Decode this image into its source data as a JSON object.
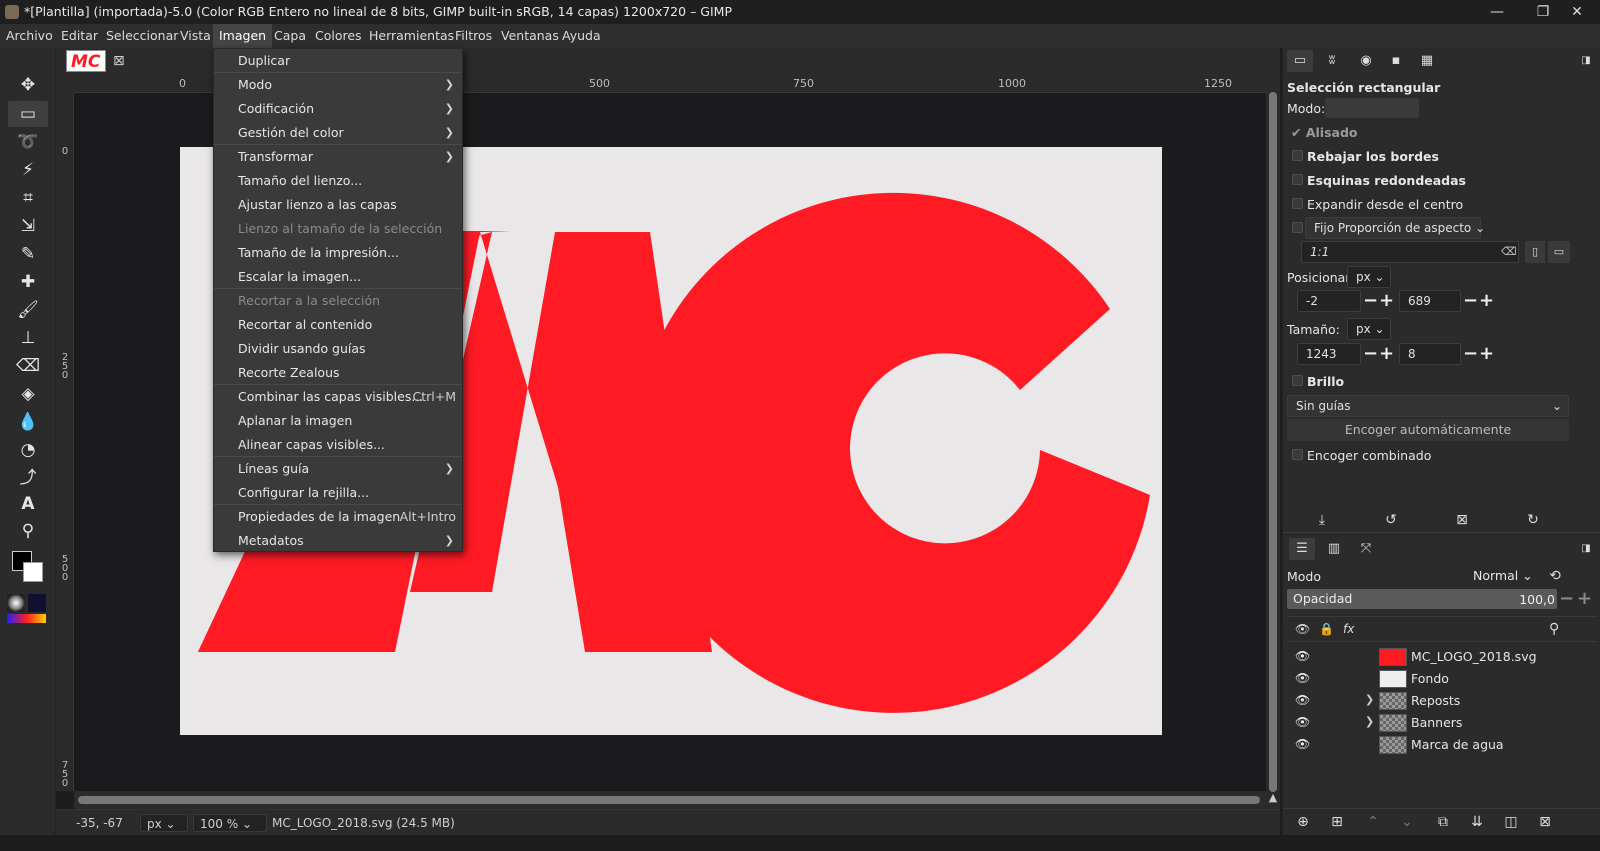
{
  "window": {
    "title": "*[Plantilla] (importada)-5.0 (Color RGB Entero no lineal de 8 bits, GIMP built-in sRGB, 14 capas) 1200x720 – GIMP",
    "minimize": "—",
    "maximize": "❐",
    "close": "✕"
  },
  "menubar": [
    "Archivo",
    "Editar",
    "Seleccionar",
    "Vista",
    "Imagen",
    "Capa",
    "Colores",
    "Herramientas",
    "Filtros",
    "Ventanas",
    "Ayuda"
  ],
  "image_tab": {
    "thumb_text": "MC",
    "close_glyph": "⊠"
  },
  "ruler_top": [
    "0",
    "500",
    "750",
    "1000",
    "1250"
  ],
  "ruler_left": [
    "0",
    "250",
    "500",
    "750"
  ],
  "image_menu": {
    "items": [
      {
        "label": "Duplicar"
      },
      {
        "label": "Modo",
        "submenu": true
      },
      {
        "label": "Codificación",
        "submenu": true
      },
      {
        "label": "Gestión del color",
        "submenu": true
      },
      {
        "label": "Transformar",
        "submenu": true
      },
      {
        "label": "Tamaño del lienzo..."
      },
      {
        "label": "Ajustar lienzo a las capas"
      },
      {
        "label": "Lienzo al tamaño de la selección",
        "disabled": true
      },
      {
        "label": "Tamaño de la impresión..."
      },
      {
        "label": "Escalar la imagen..."
      },
      {
        "label": "Recortar a la selección",
        "disabled": true
      },
      {
        "label": "Recortar al contenido"
      },
      {
        "label": "Dividir usando guías"
      },
      {
        "label": "Recorte Zealous"
      },
      {
        "label": "Combinar las capas visibles...",
        "accel": "Ctrl+M"
      },
      {
        "label": "Aplanar la imagen"
      },
      {
        "label": "Alinear capas visibles..."
      },
      {
        "label": "Líneas guía",
        "submenu": true
      },
      {
        "label": "Configurar la rejilla..."
      },
      {
        "label": "Propiedades de la imagen",
        "accel": "Alt+Intro"
      },
      {
        "label": "Metadatos",
        "submenu": true
      }
    ]
  },
  "canvas": {
    "logo_text": "MC",
    "logo_color": "#ff1a24",
    "bg_color": "#e9e7e8"
  },
  "statusbar": {
    "coords": "-35, -67",
    "unit": "px",
    "zoom": "100 %",
    "info": "MC_LOGO_2018.svg (24.5 MB)"
  },
  "tool_options": {
    "title": "Selección rectangular",
    "mode_label": "Modo:",
    "antialias": "Alisado",
    "feather": "Rebajar los bordes",
    "rounded": "Esquinas redondeadas",
    "expand": "Expandir desde el centro",
    "fixed": "Fijo Proporción de aspecto",
    "ratio": "1:1",
    "position_label": "Posicionar:",
    "position_unit": "px",
    "pos_x": "-2",
    "pos_y": "689",
    "size_label": "Tamaño:",
    "size_unit": "px",
    "size_w": "1243",
    "size_h": "8",
    "highlight": "Brillo",
    "guides": "Sin guías",
    "autoshrink": "Encoger automáticamente",
    "shrink_merged": "Encoger combinado"
  },
  "layers_panel": {
    "mode_label": "Modo",
    "mode_value": "Normal",
    "opacity_label": "Opacidad",
    "opacity_value": "100,0",
    "layers": [
      {
        "name": "MC_LOGO_2018.svg",
        "thumb": "logo"
      },
      {
        "name": "Fondo",
        "thumb": "white"
      },
      {
        "name": "Reposts",
        "thumb": "checker",
        "group": true
      },
      {
        "name": "Banners",
        "thumb": "checker",
        "group": true
      },
      {
        "name": "Marca de agua",
        "thumb": "checker"
      }
    ]
  }
}
